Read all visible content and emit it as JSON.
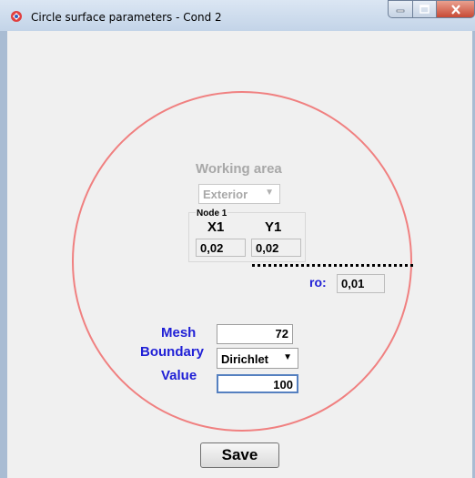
{
  "window": {
    "title": "Circle surface parameters - Cond 2",
    "icon": "app-icon",
    "controls": {
      "minimize": "minimize-icon",
      "maximize": "maximize-icon",
      "close": "close-icon"
    }
  },
  "working_area": {
    "label": "Working area",
    "mode": "Exterior"
  },
  "node": {
    "label": "Node 1",
    "x_label": "X1",
    "y_label": "Y1",
    "x_value": "0,02",
    "y_value": "0,02"
  },
  "radius": {
    "label": "ro:",
    "value": "0,01"
  },
  "mesh": {
    "label": "Mesh",
    "value": "72"
  },
  "boundary": {
    "label": "Boundary",
    "value": "Dirichlet"
  },
  "value": {
    "label": "Value",
    "value": "100"
  },
  "save_label": "Save",
  "colors": {
    "circle": "#f08080",
    "labels": "#1f1fd6",
    "disabled_text": "#a8a8a8"
  }
}
